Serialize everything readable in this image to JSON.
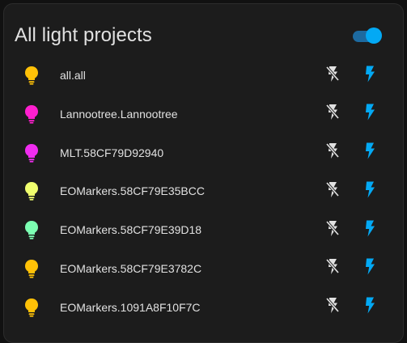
{
  "card": {
    "title": "All light projects",
    "toggle_on": true
  },
  "colors": {
    "accent": "#03a9f4",
    "toggle_track": "#1d6aa0",
    "text": "#e1e1e1",
    "icon_muted": "#e1e1e1"
  },
  "projects": [
    {
      "label": "all.all",
      "bulb_color": "#ffc107"
    },
    {
      "label": "Lannootree.Lannootree",
      "bulb_color": "#ff1fcf"
    },
    {
      "label": "MLT.58CF79D92940",
      "bulb_color": "#f02cf0"
    },
    {
      "label": "EOMarkers.58CF79E35BCC",
      "bulb_color": "#f0ff6e"
    },
    {
      "label": "EOMarkers.58CF79E39D18",
      "bulb_color": "#7cffb2"
    },
    {
      "label": "EOMarkers.58CF79E3782C",
      "bulb_color": "#ffc107"
    },
    {
      "label": "EOMarkers.1091A8F10F7C",
      "bulb_color": "#ffc107"
    }
  ],
  "icons": {
    "bulb": "lightbulb-icon",
    "off": "flash-off-icon",
    "on": "flash-icon"
  }
}
